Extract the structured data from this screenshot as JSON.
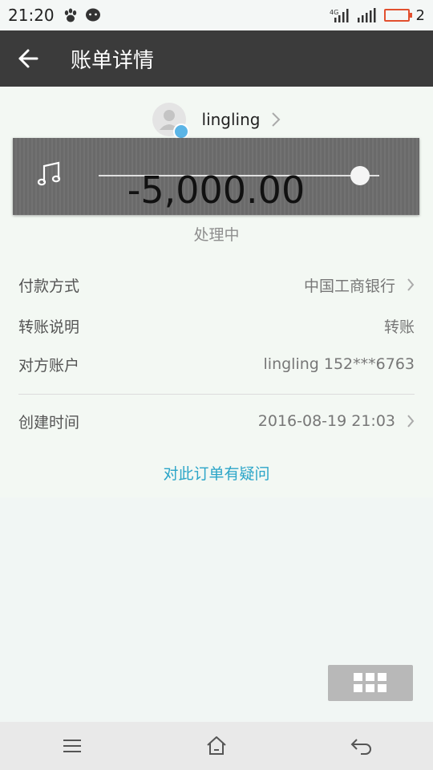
{
  "status_bar": {
    "time": "21:20",
    "battery_level": "2",
    "network_label": "4G"
  },
  "header": {
    "title": "账单详情"
  },
  "payee": {
    "name": "lingling"
  },
  "player": {
    "amount": "-5,000.00",
    "progress": 0.93
  },
  "transaction": {
    "status": "处理中",
    "details": [
      {
        "label": "付款方式",
        "value": "中国工商银行"
      },
      {
        "label": "转账说明",
        "value": "转账"
      },
      {
        "label": "对方账户",
        "value": "lingling 152***6763"
      },
      {
        "label": "创建时间",
        "value": "2016-08-19 21:03"
      }
    ],
    "question_link": "对此订单有疑问"
  },
  "colors": {
    "header_bg": "#3b3b3b",
    "link": "#2ba5c8",
    "battery": "#e2502f"
  }
}
